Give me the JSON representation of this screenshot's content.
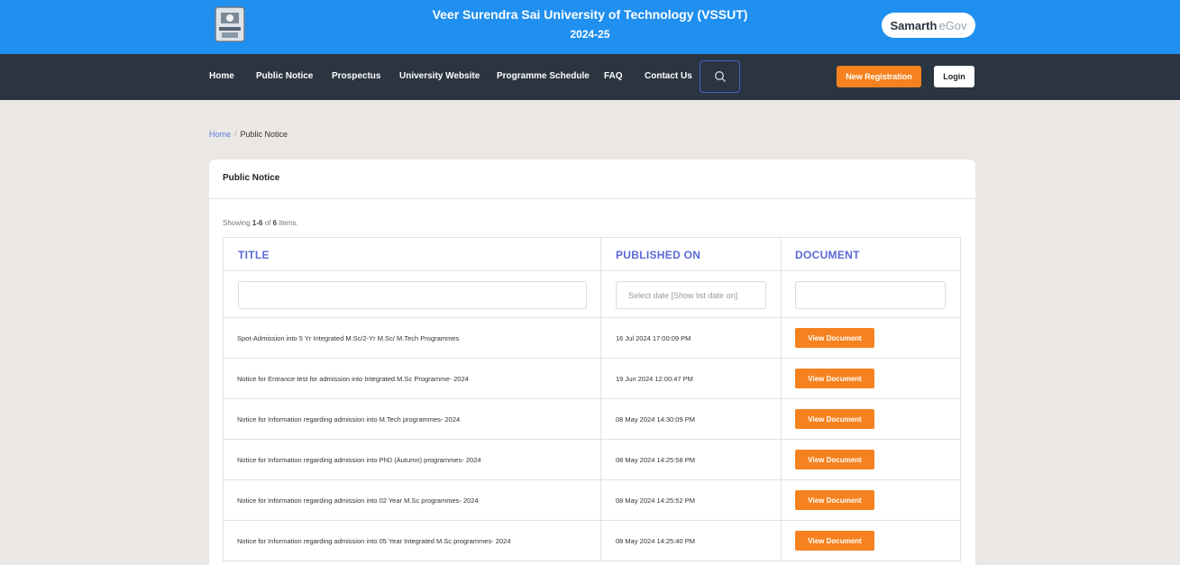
{
  "header": {
    "university": "Veer Surendra Sai University of Technology (VSSUT)",
    "year": "2024-25",
    "samarth": "Samarth",
    "egov": "eGov"
  },
  "nav": {
    "home": "Home",
    "public_notice": "Public Notice",
    "prospectus": "Prospectus",
    "university_website": "University Website",
    "programme_schedule": "Programme Schedule",
    "faq": "FAQ",
    "contact_us": "Contact Us",
    "new_registration": "New Registration",
    "login": "Login"
  },
  "breadcrumb": {
    "home": "Home",
    "separator": "/",
    "current": "Public Notice"
  },
  "card": {
    "title": "Public Notice",
    "summary_prefix": "Showing ",
    "summary_range": "1-6",
    "summary_mid": " of ",
    "summary_total": "6",
    "summary_suffix": " items."
  },
  "table": {
    "headers": [
      "TITLE",
      "PUBLISHED ON",
      "DOCUMENT"
    ],
    "filters": {
      "title_value": "",
      "date_placeholder": "Select date [Show list date on]",
      "document_value": ""
    },
    "button_label": "View Document",
    "rows": [
      {
        "title": "Spot-Admission into 5 Yr Integrated M.Sc/2-Yr M.Sc/ M.Tech Programmes",
        "published": "16 Jul 2024 17:00:09 PM"
      },
      {
        "title": "Notice for Entrance test for admission into Integrated M.Sc Programme- 2024",
        "published": "19 Jun 2024 12:00:47 PM"
      },
      {
        "title": "Notice for Information regarding admission into M.Tech programmes- 2024",
        "published": "08 May 2024 14:30:09 PM"
      },
      {
        "title": "Notice for Information regarding admission into PhD (Autumn) programmes- 2024",
        "published": "08 May 2024 14:25:58 PM"
      },
      {
        "title": "Notice for Information regarding admission into 02 Year M.Sc programmes- 2024",
        "published": "08 May 2024 14:25:52 PM"
      },
      {
        "title": "Notice for Information regarding admission into 05 Year Integrated M.Sc programmes- 2024",
        "published": "08 May 2024 14:25:40 PM"
      }
    ]
  },
  "icons": {
    "logo": "university-crest-icon",
    "search": "search-icon"
  },
  "colors": {
    "topbar": "#1f8ff0",
    "navbar": "#2b3441",
    "accent_orange": "#f5821f",
    "header_text": "#5b6ad6",
    "background": "#ebe7e5"
  }
}
